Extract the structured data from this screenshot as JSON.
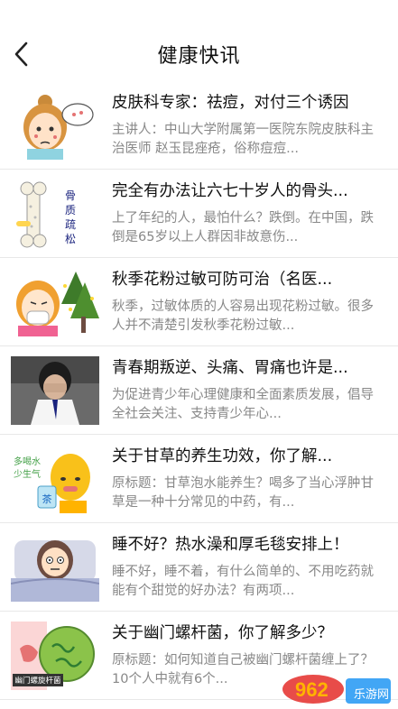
{
  "header": {
    "title": "健康快讯",
    "back_icon": "chevron-left-icon"
  },
  "articles": [
    {
      "title": "皮肤科专家：祛痘，对付三个诱因",
      "summary": "主讲人：中山大学附属第一医院东院皮肤科主治医师 赵玉昆痤疮，俗称痘痘...",
      "thumb_icon": "girl-acne-illustration"
    },
    {
      "title": "完全有办法让六七十岁人的骨头...",
      "summary": "上了年纪的人，最怕什么？跌倒。在中国，跌倒是65岁以上人群因非故意伤...",
      "thumb_icon": "osteoporosis-bone-illustration",
      "thumb_caption": "骨质疏松"
    },
    {
      "title": "秋季花粉过敏可防可治（名医...",
      "summary": "秋季，过敏体质的人容易出现花粉过敏。很多人并不清楚引发秋季花粉过敏...",
      "thumb_icon": "pollen-allergy-mask-illustration"
    },
    {
      "title": "青春期叛逆、头痛、胃痛也许是...",
      "summary": "为促进青少年心理健康和全面素质发展，倡导全社会关注、支持青少年心...",
      "thumb_icon": "crying-student-photo"
    },
    {
      "title": "关于甘草的养生功效，你了解...",
      "summary": "原标题：甘草泡水能养生？喝多了当心浮肿甘草是一种十分常见的中药，有...",
      "thumb_icon": "sick-man-tea-illustration",
      "thumb_caption": "多喝水少生气",
      "thumb_cup_text": "茶"
    },
    {
      "title": "睡不好？热水澡和厚毛毯安排上！",
      "summary": "睡不好，睡不着，有什么简单的、不用吃药就能有个甜觉的好办法？有两项...",
      "thumb_icon": "sleepless-woman-illustration"
    },
    {
      "title": "关于幽门螺杆菌，你了解多少？",
      "summary": "原标题：如何知道自己被幽门螺杆菌缠上了？10个人中就有6个...",
      "thumb_icon": "stomach-bacteria-illustration",
      "thumb_caption": "幽门螺旋杆菌"
    }
  ],
  "watermark": {
    "logo": "962",
    "site": "乐游网",
    "accent_colors": [
      "#e53935",
      "#ffb300",
      "#2196f3"
    ]
  }
}
